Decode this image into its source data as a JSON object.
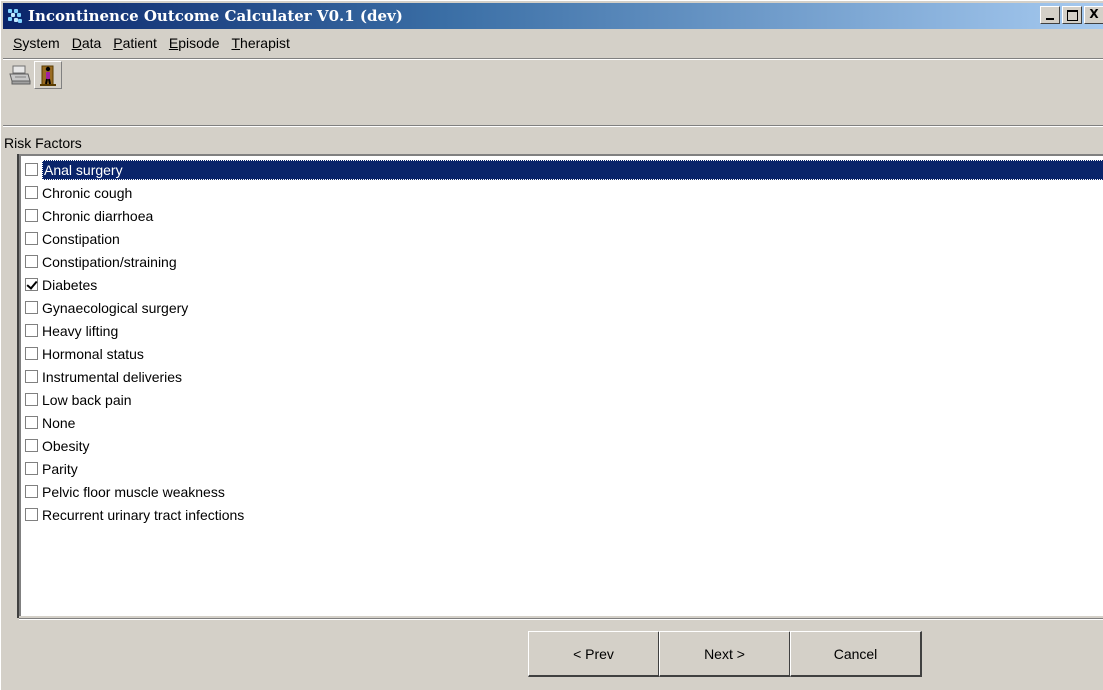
{
  "window": {
    "title": "Incontinence Outcome Calculater V0.1 (dev)",
    "controls": [
      "_",
      "□",
      "X"
    ]
  },
  "menu": [
    {
      "label": "System",
      "underline": "S",
      "rest": "ystem"
    },
    {
      "label": "Data",
      "underline": "D",
      "rest": "ata"
    },
    {
      "label": "Patient",
      "underline": "P",
      "rest": "atient"
    },
    {
      "label": "Episode",
      "underline": "E",
      "rest": "pisode"
    },
    {
      "label": "Therapist",
      "underline": "T",
      "rest": "herapist"
    }
  ],
  "toolbar": {
    "print_icon": "printer-icon",
    "exit_icon": "exit-door-icon"
  },
  "risk_factors": {
    "label": "Risk Factors",
    "selected_index": 0,
    "items": [
      {
        "label": "Anal surgery",
        "checked": false
      },
      {
        "label": "Chronic cough",
        "checked": false
      },
      {
        "label": "Chronic diarrhoea",
        "checked": false
      },
      {
        "label": "Constipation",
        "checked": false
      },
      {
        "label": "Constipation/straining",
        "checked": false
      },
      {
        "label": "Diabetes",
        "checked": true
      },
      {
        "label": "Gynaecological surgery",
        "checked": false
      },
      {
        "label": "Heavy lifting",
        "checked": false
      },
      {
        "label": "Hormonal status",
        "checked": false
      },
      {
        "label": "Instrumental deliveries",
        "checked": false
      },
      {
        "label": "Low back pain",
        "checked": false
      },
      {
        "label": "None",
        "checked": false
      },
      {
        "label": "Obesity",
        "checked": false
      },
      {
        "label": "Parity",
        "checked": false
      },
      {
        "label": "Pelvic floor muscle weakness",
        "checked": false
      },
      {
        "label": "Recurrent urinary tract infections",
        "checked": false
      }
    ]
  },
  "buttons": {
    "prev": "< Prev",
    "next": "Next >",
    "cancel": "Cancel"
  }
}
